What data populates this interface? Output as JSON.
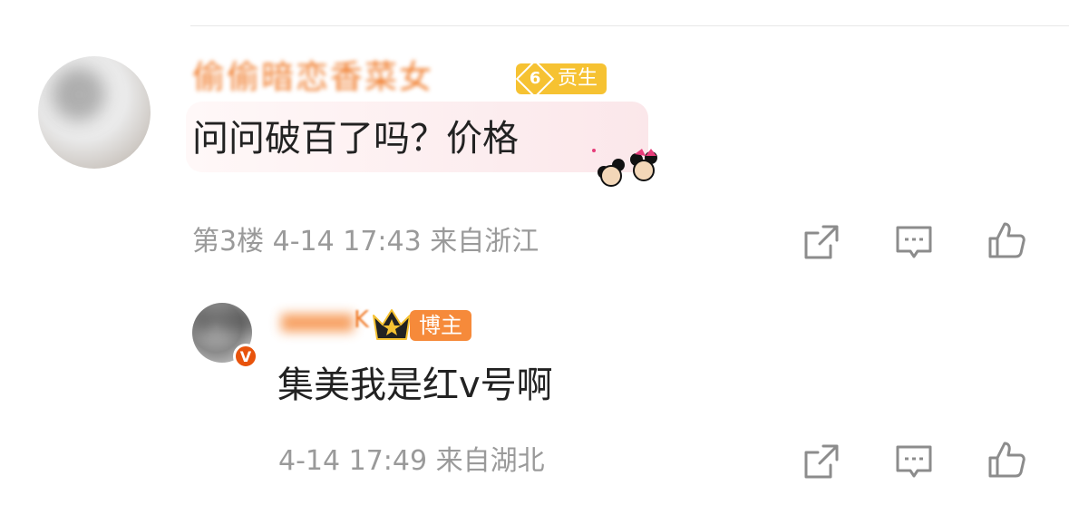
{
  "comment": {
    "author_name": "偷偷暗恋香菜女",
    "badge": {
      "level": "6",
      "label": "贡生"
    },
    "text": "问问破百了吗？价格",
    "floor": "第3楼",
    "time": "4-14 17:43",
    "location": "来自浙江",
    "actions": [
      "share-icon",
      "comment-icon",
      "like-icon"
    ]
  },
  "reply": {
    "author_name_tail": "K",
    "badge": {
      "label": "博主"
    },
    "verified_mark": "V",
    "text": "集美我是红v号啊",
    "time": "4-14 17:49",
    "location": "来自湖北",
    "actions": [
      "share-icon",
      "comment-icon",
      "like-icon"
    ]
  },
  "colors": {
    "name_orange": "#f07d2d",
    "badge_gold": "#f6c232",
    "badge_orange": "#f68a3a",
    "meta_gray": "#9a9a9a",
    "icon_gray": "#8c8c8c"
  }
}
